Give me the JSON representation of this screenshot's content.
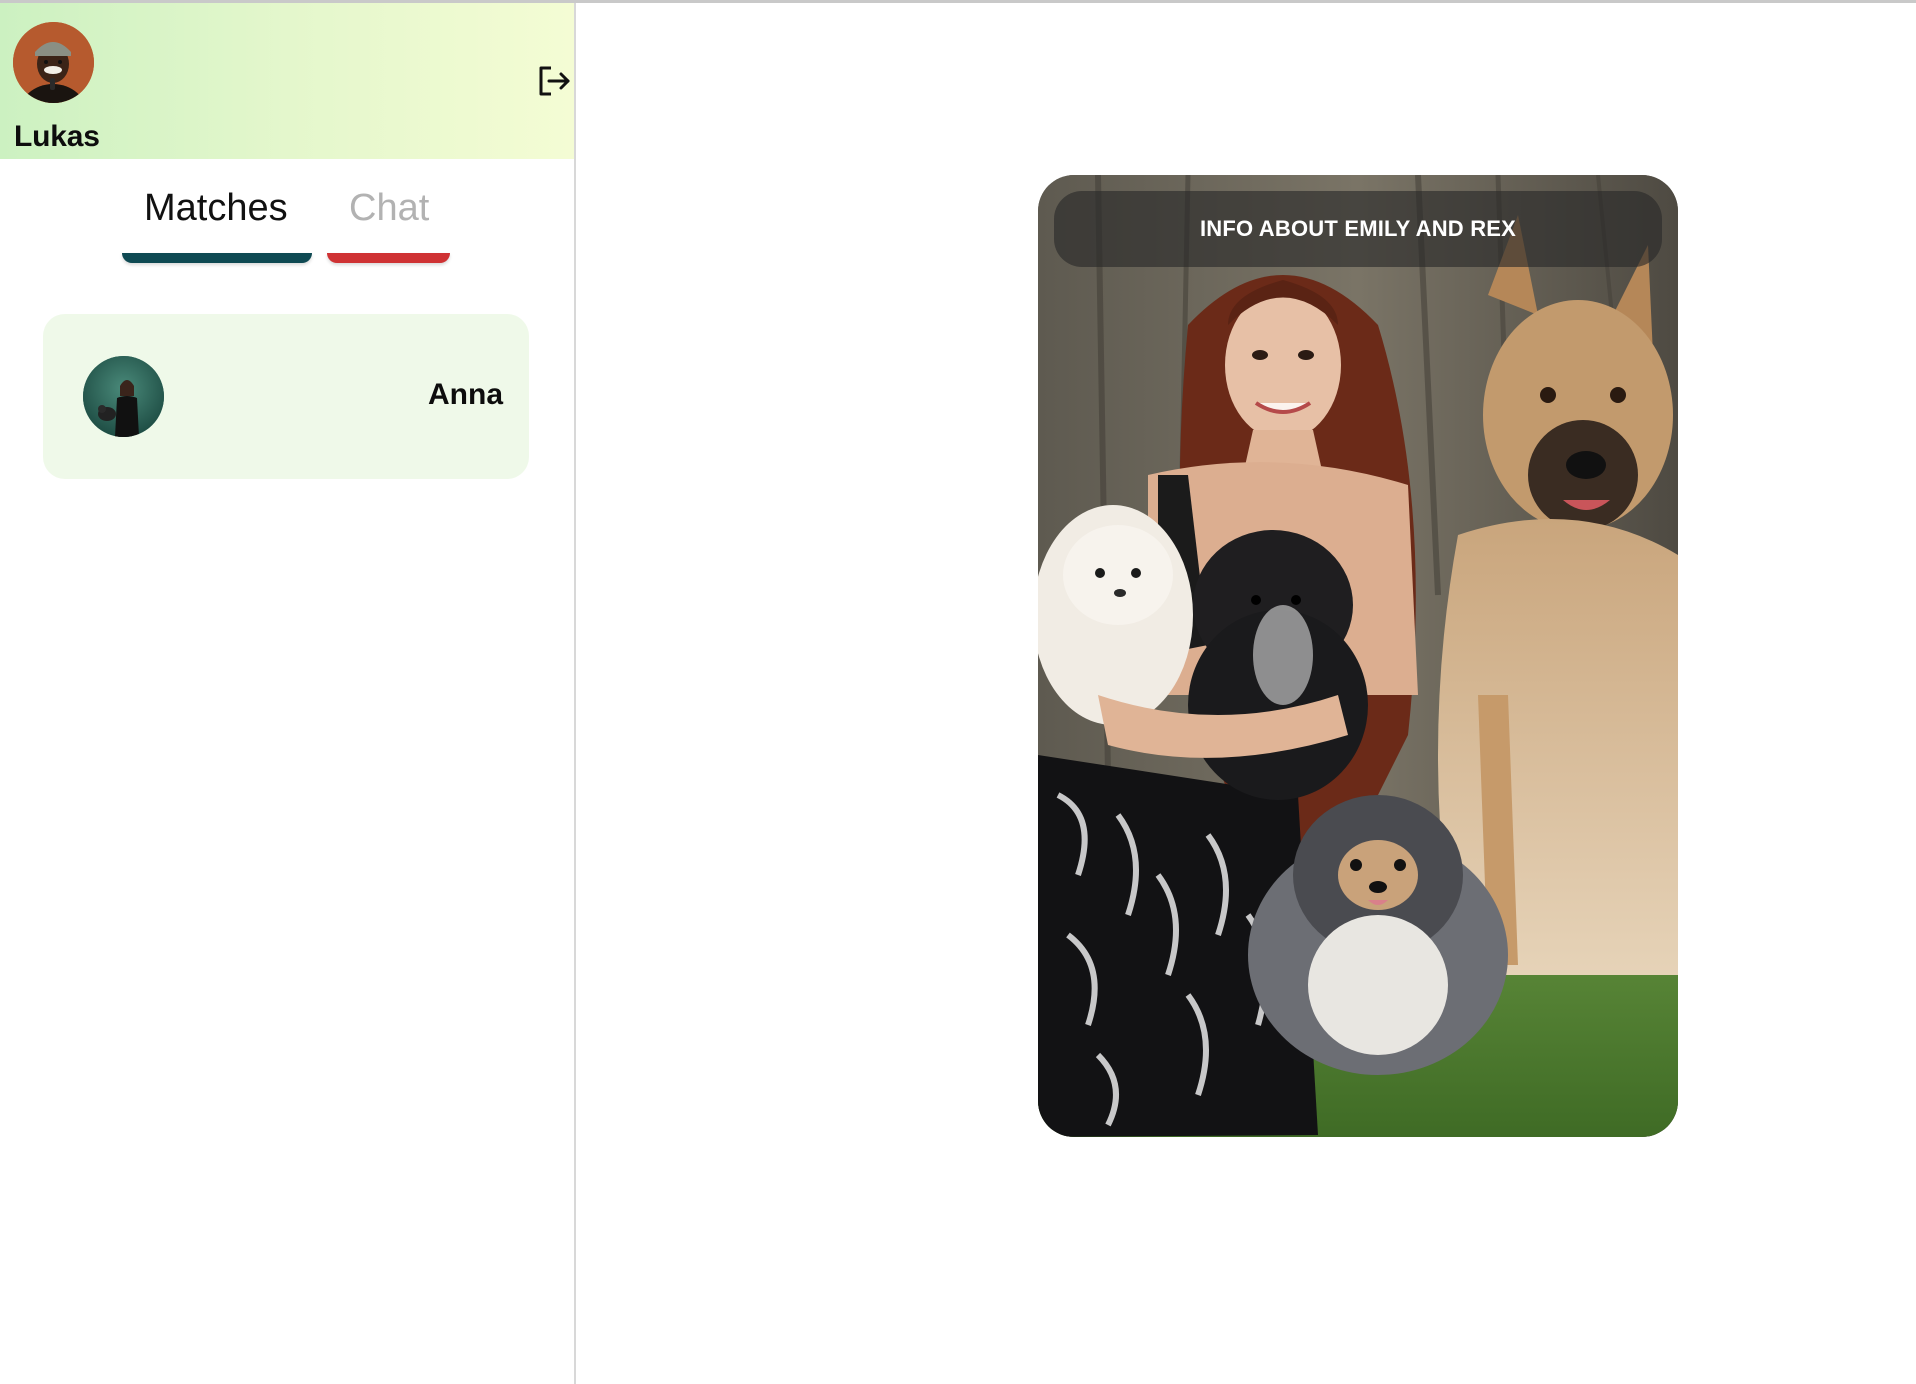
{
  "user": {
    "name": "Lukas"
  },
  "tabs": {
    "matches_label": "Matches",
    "chat_label": "Chat",
    "active": "Matches"
  },
  "matches": [
    {
      "name": "Anna"
    }
  ],
  "profile_card": {
    "info_label": "INFO ABOUT EMILY AND REX"
  },
  "colors": {
    "header_gradient_start": "#ccf1c1",
    "header_gradient_end": "#f4fcd4",
    "matches_underline": "#0f4a53",
    "chat_underline": "#cf3234",
    "match_card_bg": "#eff9e9"
  },
  "icons": {
    "logout": "logout-icon"
  }
}
